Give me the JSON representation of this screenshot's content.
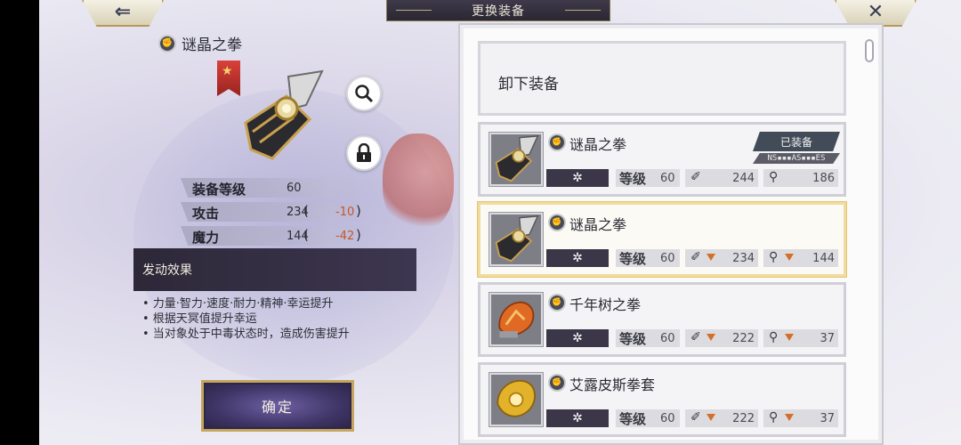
{
  "header": {
    "title": "更换装备"
  },
  "nav": {
    "back_icon": "arrow-left-icon",
    "close_icon": "close-icon"
  },
  "item": {
    "name": "谜晶之拳",
    "stats": [
      {
        "label": "装备等级",
        "value": "60",
        "delta": ""
      },
      {
        "label": "攻击",
        "value": "234",
        "delta": "-10"
      },
      {
        "label": "魔力",
        "value": "144",
        "delta": "-42"
      }
    ],
    "effect_title": "发动效果",
    "effects": [
      "• 力量·智力·速度·耐力·精神·幸运提升",
      "• 根据天冥值提升幸运",
      "• 当对象处于中毒状态时，造成伤害提升"
    ],
    "confirm_label": "确定",
    "delta_color": "#c4582c"
  },
  "list": {
    "unequip_label": "卸下装备",
    "cards": [
      {
        "name": "谜晶之拳",
        "level_label": "等级",
        "level": "60",
        "atk": "244",
        "mag": "186",
        "equipped": true,
        "equipped_label": "已装备",
        "tag": "NS▪▪▪AS▪▪▪ES",
        "atk_down": false,
        "mag_down": false,
        "selected": false
      },
      {
        "name": "谜晶之拳",
        "level_label": "等级",
        "level": "60",
        "atk": "234",
        "mag": "144",
        "equipped": false,
        "atk_down": true,
        "mag_down": true,
        "selected": true
      },
      {
        "name": "千年树之拳",
        "level_label": "等级",
        "level": "60",
        "atk": "222",
        "mag": "37",
        "equipped": false,
        "atk_down": true,
        "mag_down": true,
        "selected": false
      },
      {
        "name": "艾露皮斯拳套",
        "level_label": "等级",
        "level": "60",
        "atk": "222",
        "mag": "37",
        "equipped": false,
        "atk_down": true,
        "mag_down": true,
        "selected": false
      }
    ]
  }
}
